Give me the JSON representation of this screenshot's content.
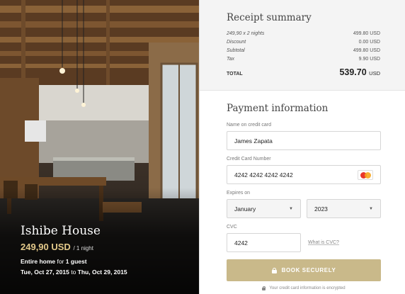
{
  "listing": {
    "title": "Ishibe House",
    "price": "249,90 USD",
    "price_unit": "/ 1 night",
    "guest_bold": "Entire home",
    "guest_mid": "for",
    "guest_count": "1 guest",
    "date_from": "Tue, Oct 27, 2015",
    "date_to_word": "to",
    "date_to": "Thu, Oct 29, 2015"
  },
  "receipt": {
    "title": "Receipt summary",
    "rows": [
      {
        "label": "249,90 x 2 nights",
        "value": "499.80 USD"
      },
      {
        "label": "Discount",
        "value": "0.00 USD"
      },
      {
        "label": "Subtotal",
        "value": "499.80 USD"
      },
      {
        "label": "Tax",
        "value": "9.90 USD"
      }
    ],
    "total_label": "TOTAL",
    "total_amount": "539.70",
    "total_currency": "USD"
  },
  "payment": {
    "title": "Payment information",
    "name_label": "Name on credit card",
    "name_value": "James Zapata",
    "card_label": "Credit Card Number",
    "card_value": "4242 4242 4242 4242",
    "card_brand_icon": "mastercard-icon",
    "expires_label": "Expires on",
    "month_value": "January",
    "year_value": "2023",
    "cvc_label": "CVC",
    "cvc_value": "4242",
    "what_cvc": "What is CVC?",
    "book_label": "BOOK SECURELY",
    "secure_note": "Your credit card information is encrypted"
  },
  "colors": {
    "accent_gold": "#c9b98a",
    "price_gold": "#e3c98a"
  }
}
